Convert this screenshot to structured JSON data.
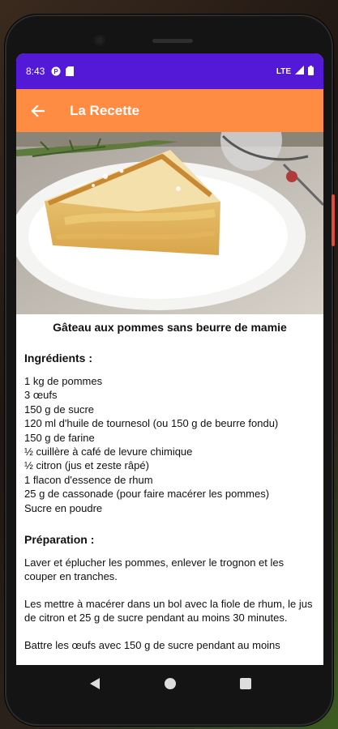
{
  "status": {
    "time": "8:43",
    "network": "LTE"
  },
  "app_bar": {
    "title": "La Recette",
    "back_icon": "arrow-left-icon"
  },
  "recipe": {
    "title": "Gâteau aux pommes sans beurre de mamie",
    "ingredients_heading": "Ingrédients :",
    "ingredients": [
      "1 kg de pommes",
      "3 œufs",
      "150 g de sucre",
      "120 ml d'huile de tournesol (ou 150 g de beurre fondu)",
      "150 g de farine",
      "½ cuillère à café de levure chimique",
      "½ citron (jus et zeste râpé)",
      "1 flacon d'essence de rhum",
      "25 g de cassonade (pour faire macérer les pommes)",
      "Sucre en poudre"
    ],
    "preparation_heading": "Préparation :",
    "preparation": [
      "Laver et éplucher les pommes, enlever le trognon et les couper en tranches.",
      "Les mettre à macérer dans un bol avec la fiole de rhum, le jus de citron et 25 g de sucre pendant au moins 30 minutes.",
      "Battre les œufs avec 150 g de sucre pendant au moins"
    ]
  },
  "colors": {
    "status_bar": "#5319d6",
    "app_bar": "#ff8c42"
  }
}
